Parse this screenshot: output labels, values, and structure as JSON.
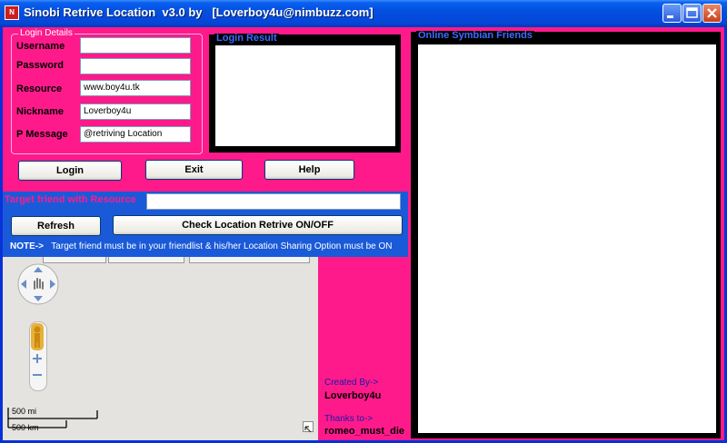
{
  "window": {
    "title": "Sinobi Retrive Location  v3.0 by   [Loverboy4u@nimbuzz.com]",
    "icon_text": "N"
  },
  "login_details": {
    "legend": "Login Details",
    "username_label": "Username",
    "username_value": "",
    "password_label": "Password",
    "password_value": "",
    "resource_label": "Resource",
    "resource_value": "www.boy4u.tk",
    "nickname_label": "Nickname",
    "nickname_value": "Loverboy4u",
    "pmessage_label": "P Message",
    "pmessage_value": "@retriving Location"
  },
  "login_result": {
    "legend": "Login Result"
  },
  "online_friends": {
    "legend": "Online Symbian Friends"
  },
  "buttons": {
    "login": "Login",
    "exit": "Exit",
    "help": "Help",
    "refresh": "Refresh",
    "check_location": "Check Location Retrive ON/OFF"
  },
  "target": {
    "label": "Target friend with Resource",
    "value": ""
  },
  "note": {
    "prefix": "NOTE->",
    "text": "Target friend must be in your friendlist & his/her Location Sharing Option must be ON"
  },
  "map": {
    "scale_mi": "500 mi",
    "scale_km": "500 km"
  },
  "credits": {
    "created_by_label": "Created By->",
    "created_by": "Loverboy4u",
    "thanks_label": "Thanks to->",
    "thanks": "romeo_must_die"
  },
  "colors": {
    "pink": "#ff1a8c",
    "blue": "#1a5ad8",
    "titlebar": "#0350e0"
  }
}
